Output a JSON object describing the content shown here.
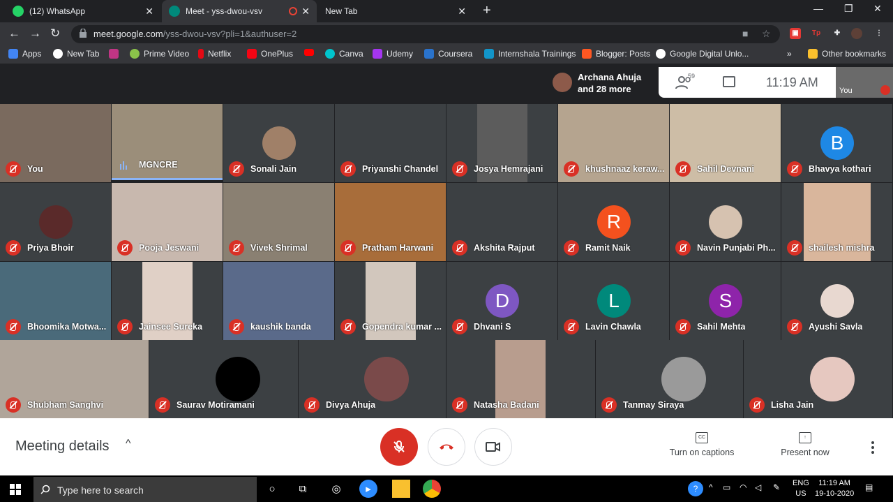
{
  "browser": {
    "tabs": [
      {
        "title": "(12) WhatsApp",
        "icon": "whatsapp-icon",
        "color": "#25d366"
      },
      {
        "title": "Meet - yss-dwou-vsv",
        "icon": "meet-icon",
        "color": "#00897b"
      },
      {
        "title": "New Tab",
        "icon": "",
        "color": ""
      }
    ],
    "url_host": "meet.google.com",
    "url_path": "/yss-dwou-vsv?pli=1&authuser=2",
    "bookmarks": [
      "Apps",
      "New Tab",
      "",
      "Prime Video",
      "Netflix",
      "OnePlus",
      "",
      "Canva",
      "Udemy",
      "Coursera",
      "Internshala Trainings",
      "Blogger: Posts",
      "Google Digital Unlo...",
      "Other bookmarks"
    ]
  },
  "meet": {
    "presenter_label": "Archana Ahuja",
    "presenter_more": "and 28 more",
    "participant_count": "59",
    "time": "11:19  AM",
    "self_thumb_label": "You",
    "participants": [
      "You",
      "MGNCRE",
      "Sonali Jain",
      "Priyanshi Chandel",
      "Josya Hemrajani",
      "khushnaaz keraw...",
      "Sahil Devnani",
      "Bhavya kothari",
      "Priya Bhoir",
      "Pooja Jeswani",
      "Vivek Shrimal",
      "Pratham Harwani",
      "Akshita Rajput",
      "Ramit Naik",
      "Navin Punjabi Ph...",
      "shailesh mishra",
      "Bhoomika Motwa...",
      "Jainsee Sureka",
      "kaushik banda",
      "Gopendra kumar ...",
      "Dhvani S",
      "Lavin Chawla",
      "Sahil Mehta",
      "Ayushi Savla",
      "Shubham Sanghvi",
      "Saurav Motiramani",
      "Divya Ahuja",
      "Natasha Badani",
      "Tanmay Siraya",
      "Lisha Jain"
    ],
    "avatars": {
      "Bhavya kothari": {
        "letter": "B",
        "color": "#1e88e5"
      },
      "Ramit Naik": {
        "letter": "R",
        "color": "#f4511e"
      },
      "Dhvani S": {
        "letter": "D",
        "color": "#7e57c2"
      },
      "Lavin Chawla": {
        "letter": "L",
        "color": "#00897b"
      },
      "Sahil Mehta": {
        "letter": "S",
        "color": "#8e24aa"
      }
    },
    "meeting_details": "Meeting details",
    "captions_label": "Turn on captions",
    "present_label": "Present now"
  },
  "taskbar": {
    "search_placeholder": "Type here to search",
    "lang": "ENG",
    "region": "US",
    "time": "11:19 AM",
    "date": "19-10-2020"
  }
}
